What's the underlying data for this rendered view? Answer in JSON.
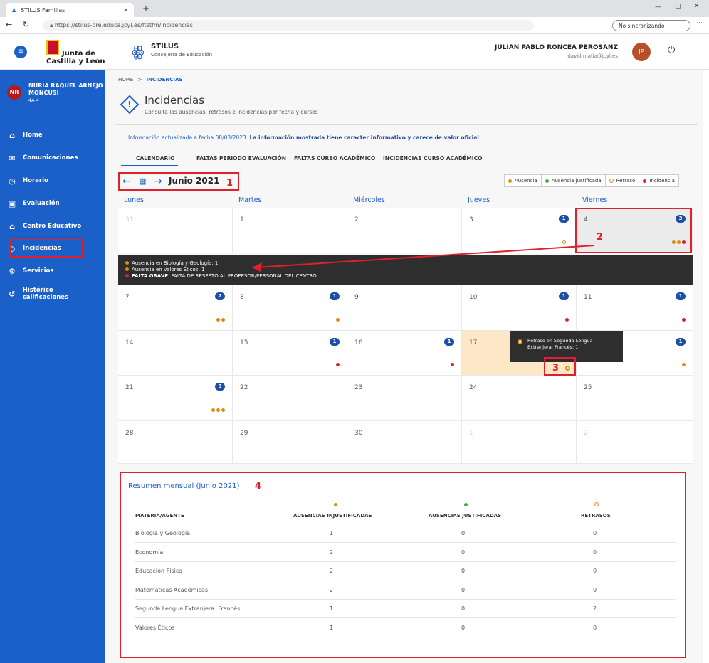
{
  "browser": {
    "tab_title": "STILUS Familias",
    "url": "https://stilus-pre.educa.jcyl.es/ftstfm/incidencias",
    "sync_label": "No sincronizando"
  },
  "header": {
    "logo_line1": "Junta de",
    "logo_line2": "Castilla y León",
    "app_name": "STILUS",
    "app_sub": "Consejería de Educación",
    "user_name": "JULIAN PABLO RONCEA PEROSANZ",
    "user_email": "david.matia@jcyl.es",
    "user_initials": "JP"
  },
  "sidebar": {
    "student_initials": "NR",
    "student_name_1": "NURIA RAQUEL ARNEJO",
    "student_name_2": "MONCUSI",
    "student_class": "4A 4",
    "items": [
      {
        "label": "Home"
      },
      {
        "label": "Comunicaciones"
      },
      {
        "label": "Horario"
      },
      {
        "label": "Evaluación"
      },
      {
        "label": "Centro Educativo"
      },
      {
        "label": "Incidencias"
      },
      {
        "label": "Servicios"
      },
      {
        "label": "Histórico calificaciones"
      }
    ]
  },
  "breadcrumb": {
    "home": "HOME",
    "sep": ">",
    "current": "INCIDENCIAS"
  },
  "page": {
    "title": "Incidencias",
    "subtitle": "Consulta las ausencias, retrasos e incidencias por fecha y cursos",
    "info_prefix": "Información actualizada a fecha 08/03/2023.",
    "info_bold": "La información mostrada tiene caracter informativo y carece de valor oficial"
  },
  "tabs": [
    "CALENDARIO",
    "FALTAS PERIODO EVALUACIÓN",
    "FALTAS CURSO ACADÉMICO",
    "INCIDENCIAS CURSO ACADÉMICO"
  ],
  "calendar": {
    "month_label": "Junio 2021",
    "legend": [
      "Ausencia",
      "Ausencia justificada",
      "Retraso",
      "Incidencia"
    ],
    "colors": {
      "ausencia": "#e08c0b",
      "justificada": "#2db34a",
      "retraso": "#e08c0b",
      "incidencia": "#e0202a"
    },
    "weekdays": [
      "Lunes",
      "Martes",
      "Miércoles",
      "Jueves",
      "Viernes"
    ],
    "rows": [
      [
        "31",
        "1",
        "2",
        "3",
        "4"
      ],
      [
        "7",
        "8",
        "9",
        "10",
        "11"
      ],
      [
        "14",
        "15",
        "16",
        "17",
        ""
      ],
      [
        "21",
        "22",
        "23",
        "24",
        "25"
      ],
      [
        "28",
        "29",
        "30",
        "1",
        "2"
      ]
    ],
    "badges": {
      "r0c3": "1",
      "r0c4": "3",
      "r1c0": "2",
      "r1c1": "1",
      "r1c3": "1",
      "r1c4": "1",
      "r2c1": "1",
      "r2c2": "1",
      "r2c4": "1",
      "r3c0": "3"
    },
    "popup": {
      "line1": "Ausencia en Biología y Geología: 1",
      "line2": "Ausencia en Valores Éticos: 1",
      "line3_bold": "FALTA GRAVE",
      "line3_rest": ": FALTA DE RESPETO AL PROFESOR/PERSONAL DEL CENTRO"
    },
    "tooltip": {
      "line1": "Retraso en Segunda Lengua",
      "line2": "Extranjera: Francés: 1"
    }
  },
  "annotations": [
    "1",
    "2",
    "3",
    "4"
  ],
  "summary": {
    "title": "Resumen mensual (Junio 2021)",
    "headers": [
      "MATERIA/AGENTE",
      "AUSENCIAS INJUSTIFICADAS",
      "AUSENCIAS JUSTIFICADAS",
      "RETRASOS"
    ],
    "rows": [
      [
        "Biología y Geología",
        "1",
        "0",
        "0"
      ],
      [
        "Economía",
        "2",
        "0",
        "0"
      ],
      [
        "Educación Física",
        "2",
        "0",
        "0"
      ],
      [
        "Matemáticas Académicas",
        "2",
        "0",
        "0"
      ],
      [
        "Segunda Lengua Extranjera: Francés",
        "1",
        "0",
        "2"
      ],
      [
        "Valores Éticos",
        "1",
        "0",
        "0"
      ]
    ]
  }
}
